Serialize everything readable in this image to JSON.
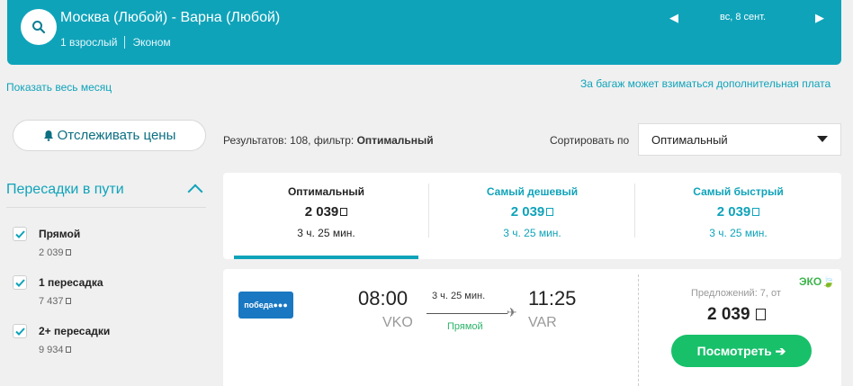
{
  "header": {
    "route": "Москва (Любой) - Варна (Любой)",
    "passengers": "1 взрослый",
    "cabin": "Эконом",
    "date": "вс, 8 сент.",
    "prev_arrow": "◀",
    "next_arrow": "▶"
  },
  "links": {
    "show_month": "Показать весь месяц",
    "baggage_note": "За багаж может взиматься дополнительная плата"
  },
  "track_button": "Отслеживать цены",
  "results": {
    "prefix": "Результатов: 108, фильтр: ",
    "filter": "Оптимальный"
  },
  "sort": {
    "label": "Сортировать по",
    "value": "Оптимальный"
  },
  "filters": {
    "title": "Пересадки в пути",
    "options": [
      {
        "label": "Прямой",
        "price": "2 039",
        "checked": true
      },
      {
        "label": "1 пересадка",
        "price": "7 437",
        "checked": true
      },
      {
        "label": "2+ пересадки",
        "price": "9 934",
        "checked": true
      }
    ]
  },
  "tabs": [
    {
      "title": "Оптимальный",
      "price": "2 039",
      "duration": "3 ч. 25 мин."
    },
    {
      "title": "Самый дешевый",
      "price": "2 039",
      "duration": "3 ч. 25 мин."
    },
    {
      "title": "Самый быстрый",
      "price": "2 039",
      "duration": "3 ч. 25 мин."
    }
  ],
  "flight": {
    "airline": "победа",
    "dep_time": "08:00",
    "arr_time": "11:25",
    "dep_code": "VKO",
    "arr_code": "VAR",
    "duration": "3 ч. 25 мин.",
    "stops": "Прямой",
    "offers": "Предложений: 7, от",
    "eco_badge": "ЭКО",
    "price": "2 039",
    "view_button": "Посмотреть ➔"
  },
  "colors": {
    "accent": "#0fa3ba",
    "cta": "#18c06a",
    "eco": "#3cb44b"
  }
}
